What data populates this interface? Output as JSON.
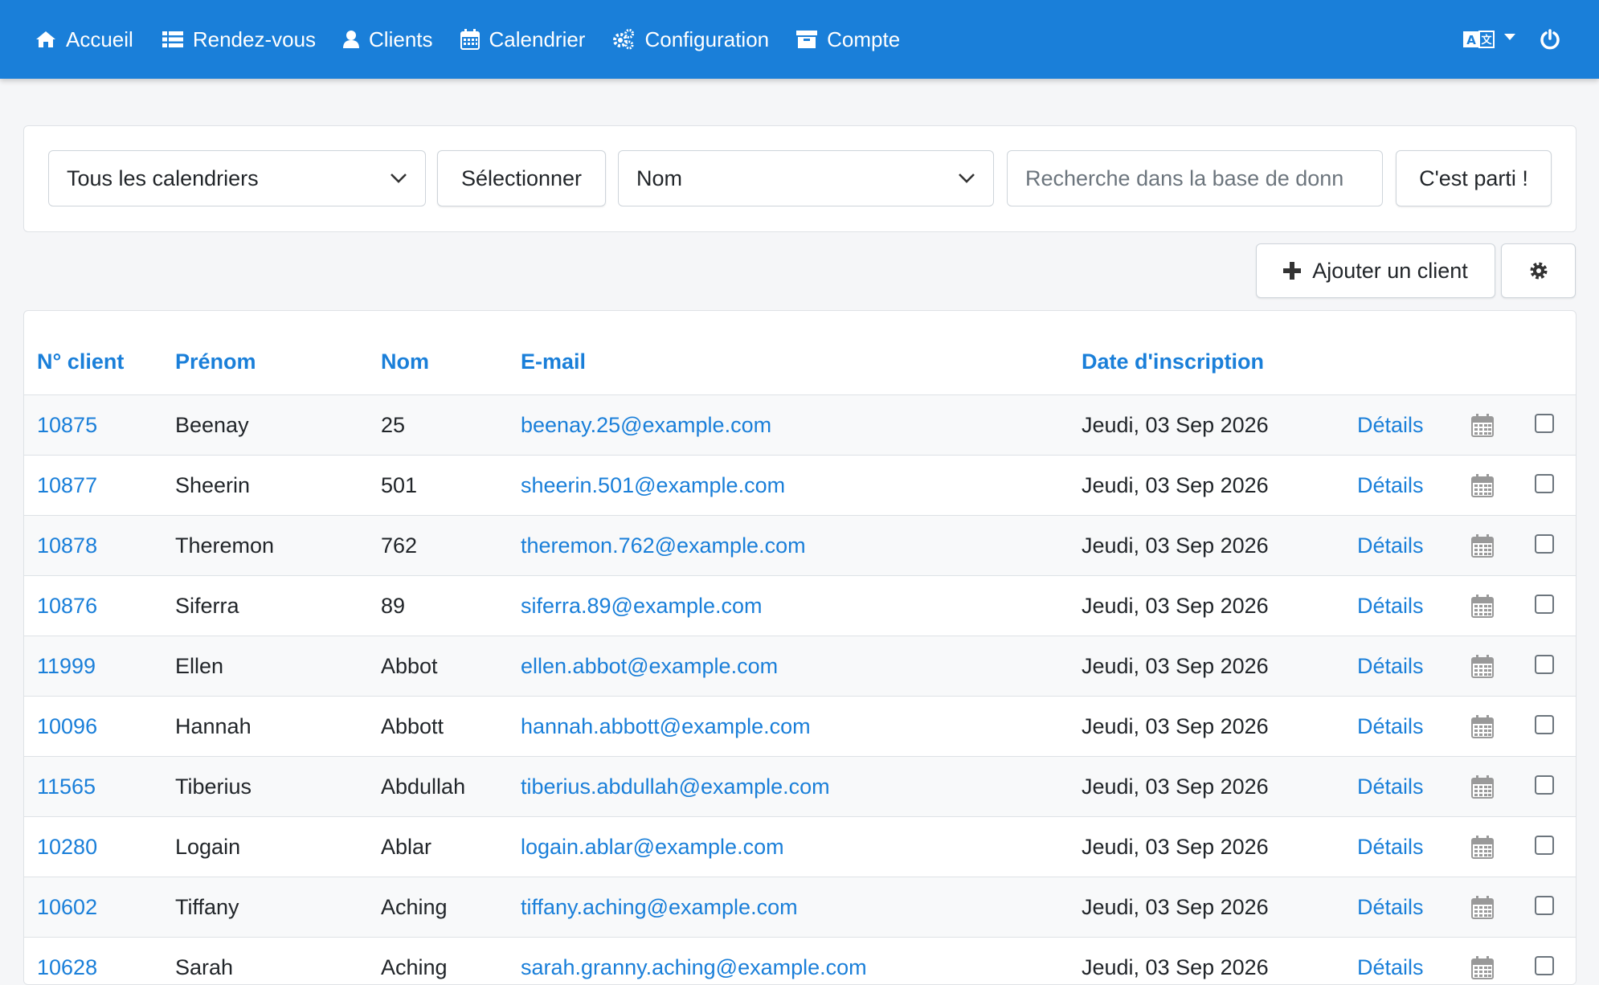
{
  "nav": {
    "items": [
      {
        "label": "Accueil",
        "icon": "home-icon"
      },
      {
        "label": "Rendez-vous",
        "icon": "list-icon"
      },
      {
        "label": "Clients",
        "icon": "user-icon"
      },
      {
        "label": "Calendrier",
        "icon": "calendar-icon"
      },
      {
        "label": "Configuration",
        "icon": "gears-icon"
      },
      {
        "label": "Compte",
        "icon": "archive-icon"
      }
    ],
    "language_icon": "translate-icon",
    "logout_icon": "power-icon",
    "accent_color": "#1a7fd9"
  },
  "filters": {
    "calendar_select": "Tous les calendriers",
    "select_button": "Sélectionner",
    "field_select": "Nom",
    "search_placeholder": "Recherche dans la base de donn",
    "search_value": "",
    "go_button": "C'est parti !"
  },
  "toolbar": {
    "add_client_label": "Ajouter un client",
    "add_icon": "plus-icon",
    "settings_icon": "gear-icon"
  },
  "table": {
    "headers": {
      "id": "N° client",
      "first_name": "Prénom",
      "last_name": "Nom",
      "email": "E-mail",
      "signup_date": "Date d'inscription"
    },
    "rows": [
      {
        "id": "10875",
        "first_name": "Beenay",
        "last_name": "25",
        "email": "beenay.25@example.com",
        "date": "Jeudi, 03 Sep 2026",
        "details": "Détails",
        "checked": false
      },
      {
        "id": "10877",
        "first_name": "Sheerin",
        "last_name": "501",
        "email": "sheerin.501@example.com",
        "date": "Jeudi, 03 Sep 2026",
        "details": "Détails",
        "checked": false
      },
      {
        "id": "10878",
        "first_name": "Theremon",
        "last_name": "762",
        "email": "theremon.762@example.com",
        "date": "Jeudi, 03 Sep 2026",
        "details": "Détails",
        "checked": false
      },
      {
        "id": "10876",
        "first_name": "Siferra",
        "last_name": "89",
        "email": "siferra.89@example.com",
        "date": "Jeudi, 03 Sep 2026",
        "details": "Détails",
        "checked": false
      },
      {
        "id": "11999",
        "first_name": "Ellen",
        "last_name": "Abbot",
        "email": "ellen.abbot@example.com",
        "date": "Jeudi, 03 Sep 2026",
        "details": "Détails",
        "checked": false
      },
      {
        "id": "10096",
        "first_name": "Hannah",
        "last_name": "Abbott",
        "email": "hannah.abbott@example.com",
        "date": "Jeudi, 03 Sep 2026",
        "details": "Détails",
        "checked": false
      },
      {
        "id": "11565",
        "first_name": "Tiberius",
        "last_name": "Abdullah",
        "email": "tiberius.abdullah@example.com",
        "date": "Jeudi, 03 Sep 2026",
        "details": "Détails",
        "checked": false
      },
      {
        "id": "10280",
        "first_name": "Logain",
        "last_name": "Ablar",
        "email": "logain.ablar@example.com",
        "date": "Jeudi, 03 Sep 2026",
        "details": "Détails",
        "checked": false
      },
      {
        "id": "10602",
        "first_name": "Tiffany",
        "last_name": "Aching",
        "email": "tiffany.aching@example.com",
        "date": "Jeudi, 03 Sep 2026",
        "details": "Détails",
        "checked": false
      },
      {
        "id": "10628",
        "first_name": "Sarah",
        "last_name": "Aching",
        "email": "sarah.granny.aching@example.com",
        "date": "Jeudi, 03 Sep 2026",
        "details": "Détails",
        "checked": false
      }
    ],
    "calendar_icon": "calendar-icon"
  }
}
